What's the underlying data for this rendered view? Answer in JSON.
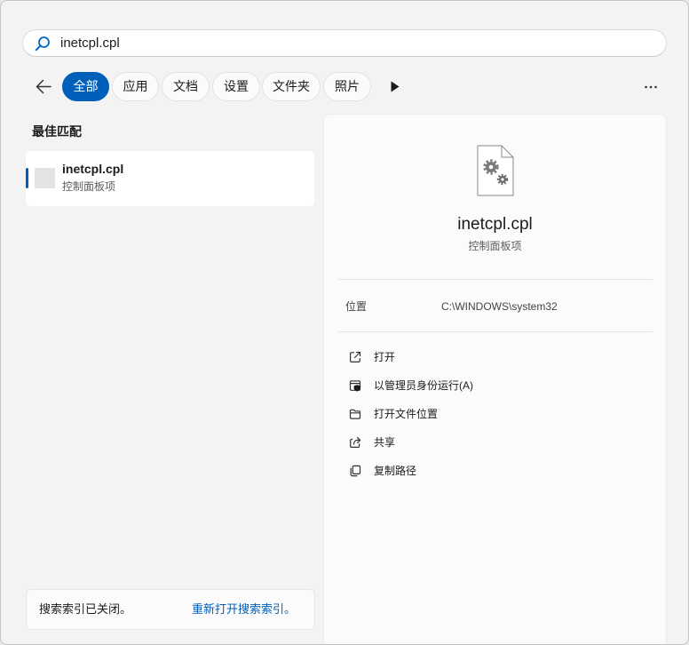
{
  "colors": {
    "accent": "#005fb8",
    "background": "#f3f3f3",
    "panel": "#fbfbfb"
  },
  "search": {
    "value": "inetcpl.cpl",
    "icon": "search-icon"
  },
  "toolbar": {
    "back_icon": "back-arrow-icon",
    "filters": [
      {
        "label": "全部",
        "selected": true
      },
      {
        "label": "应用",
        "selected": false
      },
      {
        "label": "文档",
        "selected": false
      },
      {
        "label": "设置",
        "selected": false
      },
      {
        "label": "文件夹",
        "selected": false
      },
      {
        "label": "照片",
        "selected": false
      }
    ],
    "more_filters_icon": "play-icon",
    "options_icon": "more-icon"
  },
  "best_match": {
    "heading": "最佳匹配",
    "item": {
      "title": "inetcpl.cpl",
      "subtitle": "控制面板项",
      "icon": "app-placeholder-icon"
    }
  },
  "index_notice": {
    "text": "搜索索引已关闭。",
    "link": "重新打开搜索索引。"
  },
  "detail": {
    "icon": "control-panel-file-icon",
    "title": "inetcpl.cpl",
    "subtitle": "控制面板项",
    "location": {
      "label": "位置",
      "value": "C:\\WINDOWS\\system32"
    },
    "actions": [
      {
        "label": "打开",
        "icon": "open-external-icon"
      },
      {
        "label": "以管理员身份运行(A)",
        "icon": "run-as-admin-icon"
      },
      {
        "label": "打开文件位置",
        "icon": "folder-icon"
      },
      {
        "label": "共享",
        "icon": "share-icon"
      },
      {
        "label": "复制路径",
        "icon": "copy-icon"
      }
    ]
  }
}
